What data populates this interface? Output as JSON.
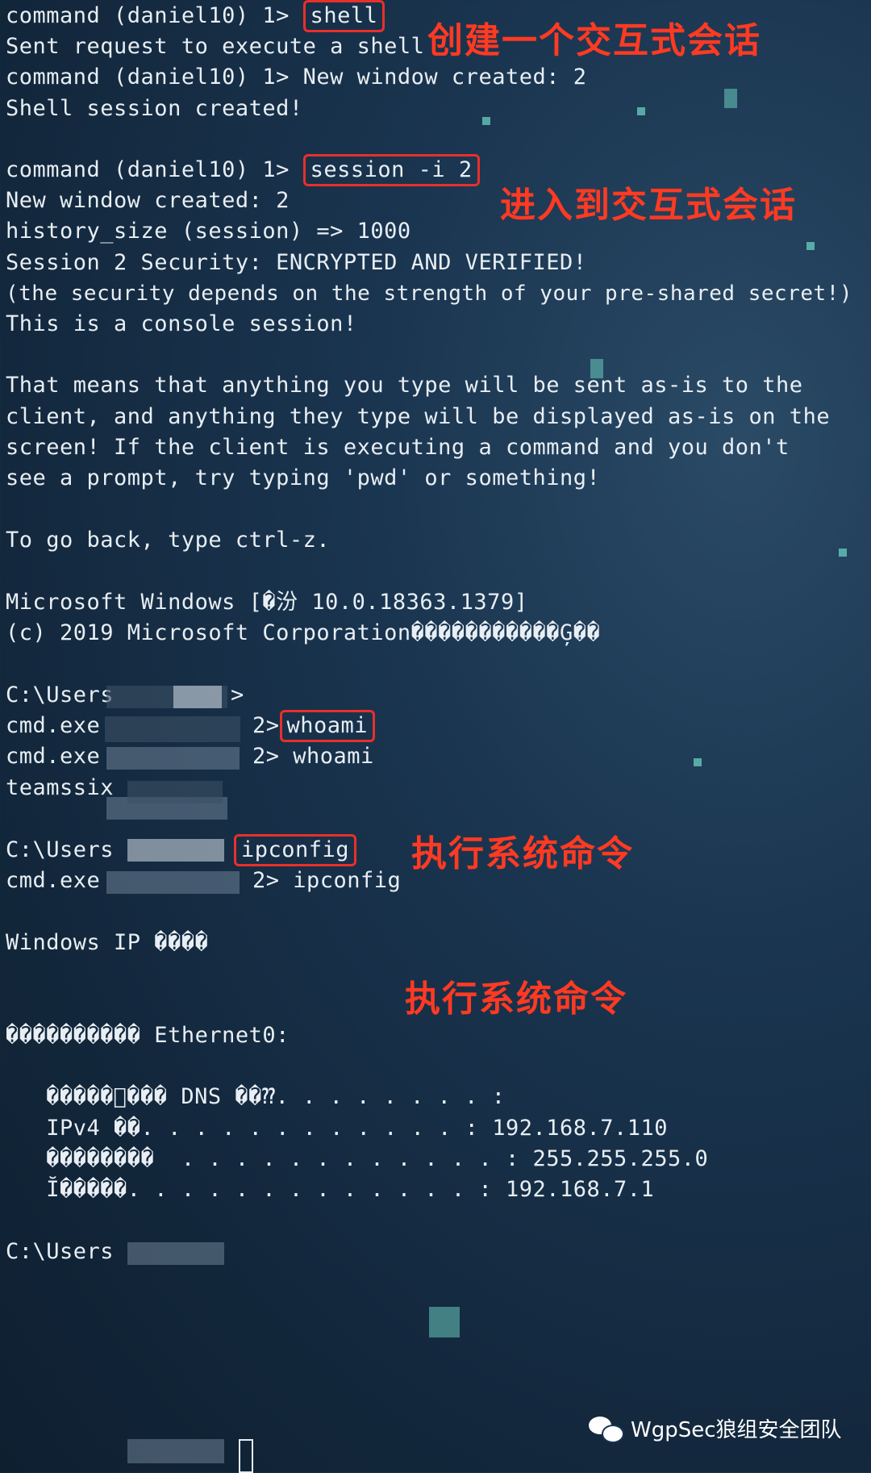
{
  "terminal": {
    "lines": [
      "command (daniel10) 1> ",
      "Sent request to execute a shell",
      "command (daniel10) 1> New window created: 2",
      "Shell session created!",
      "",
      "command (daniel10) 1> ",
      "New window created: 2",
      "history_size (session) => 1000",
      "Session 2 Security: ENCRYPTED AND VERIFIED!",
      "(the security depends on the strength of your pre-shared secret!)",
      "This is a console session!",
      "",
      "That means that anything you type will be sent as-is to the",
      "client, and anything they type will be displayed as-is on the",
      "screen! If the client is executing a command and you don't",
      "see a prompt, try typing 'pwd' or something!",
      "",
      "To go back, type ctrl-z.",
      "",
      "Microsoft Windows [�汾 10.0.18363.1379]",
      "(c) 2019 Microsoft Corporation�����������Ģ��",
      "",
      "C:\\Users",
      "cmd.exe",
      "cmd.exe",
      "teamssix",
      "",
      "C:\\Users",
      "cmd.exe",
      "",
      "Windows IP ����",
      "",
      "",
      "���������� Ethernet0:",
      "",
      "   �����ุ��� DNS ��⁇. . . . . . . . :",
      "   IPv4 ��. . . . . . . . . . . . : 192.168.7.110",
      "   ��������  . . . . . . . . . . . . : 255.255.255.0",
      "   Ĭ�����. . . . . . . . . . . . . : 192.168.7.1",
      "",
      "C:\\Users"
    ],
    "cmd_shell": "shell",
    "cmd_session": "session -i 2",
    "cmd_whoami": "whoami",
    "prompt_2": "2>",
    "whoami_echo": "2> whoami",
    "cmd_ipconfig": "ipconfig",
    "ipconfig_echo": "2> ipconfig",
    "prompt_gt": ">"
  },
  "annotations": {
    "create_session": "创建一个交互式会话",
    "enter_session": "进入到交互式会话",
    "exec_cmd_1": "执行系统命令",
    "exec_cmd_2": "执行系统命令"
  },
  "watermark": "WgpSec狼组安全团队",
  "colors": {
    "annotation": "#ff3a22",
    "highlight_border": "#e8302a",
    "text": "#e8eef3"
  }
}
